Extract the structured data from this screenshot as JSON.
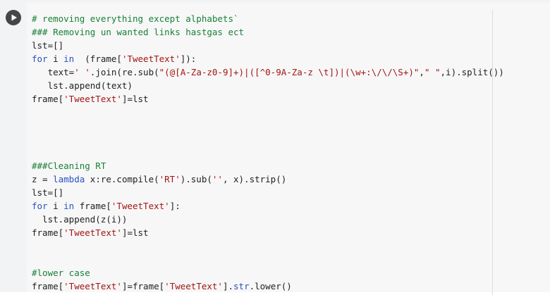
{
  "cell": {
    "run_icon": "play-icon",
    "colors": {
      "comment": "#188038",
      "keyword": "#2a52be",
      "string": "#a31515",
      "text": "#202124",
      "background": "#f7f7f7",
      "gutter": "#f1f3f4"
    },
    "lines": [
      [
        {
          "t": "comment",
          "v": "# removing everything except alphabets`"
        }
      ],
      [
        {
          "t": "comment",
          "v": "### Removing un wanted links hastgas ect"
        }
      ],
      [
        {
          "t": "plain",
          "v": "lst=[]"
        }
      ],
      [
        {
          "t": "keyword",
          "v": "for"
        },
        {
          "t": "plain",
          "v": " i "
        },
        {
          "t": "keyword",
          "v": "in"
        },
        {
          "t": "plain",
          "v": "  (frame["
        },
        {
          "t": "string",
          "v": "'TweetText'"
        },
        {
          "t": "plain",
          "v": "]):"
        }
      ],
      [
        {
          "t": "plain",
          "v": "   text="
        },
        {
          "t": "string",
          "v": "' '"
        },
        {
          "t": "plain",
          "v": ".join(re.sub("
        },
        {
          "t": "string",
          "v": "\"(@[A-Za-z0-9]+)|([^0-9A-Za-z \\t])|(\\w+:\\/\\/\\S+)\""
        },
        {
          "t": "plain",
          "v": ","
        },
        {
          "t": "string",
          "v": "\" \""
        },
        {
          "t": "plain",
          "v": ",i).split())"
        }
      ],
      [
        {
          "t": "plain",
          "v": "   lst.append(text)"
        }
      ],
      [
        {
          "t": "plain",
          "v": "frame["
        },
        {
          "t": "string",
          "v": "'TweetText'"
        },
        {
          "t": "plain",
          "v": "]=lst"
        }
      ],
      [],
      [],
      [],
      [],
      [
        {
          "t": "comment",
          "v": "###Cleaning RT"
        }
      ],
      [
        {
          "t": "plain",
          "v": "z = "
        },
        {
          "t": "keyword",
          "v": "lambda"
        },
        {
          "t": "plain",
          "v": " x:re.compile("
        },
        {
          "t": "string",
          "v": "'RT'"
        },
        {
          "t": "plain",
          "v": ").sub("
        },
        {
          "t": "string",
          "v": "''"
        },
        {
          "t": "plain",
          "v": ", x).strip()"
        }
      ],
      [
        {
          "t": "plain",
          "v": "lst=[]"
        }
      ],
      [
        {
          "t": "keyword",
          "v": "for"
        },
        {
          "t": "plain",
          "v": " i "
        },
        {
          "t": "keyword",
          "v": "in"
        },
        {
          "t": "plain",
          "v": " frame["
        },
        {
          "t": "string",
          "v": "'TweetText'"
        },
        {
          "t": "plain",
          "v": "]:"
        }
      ],
      [
        {
          "t": "plain",
          "v": "  lst.append(z(i))"
        }
      ],
      [
        {
          "t": "plain",
          "v": "frame["
        },
        {
          "t": "string",
          "v": "'TweetText'"
        },
        {
          "t": "plain",
          "v": "]=lst"
        }
      ],
      [],
      [],
      [
        {
          "t": "comment",
          "v": "#lower case"
        }
      ],
      [
        {
          "t": "plain",
          "v": "frame["
        },
        {
          "t": "string",
          "v": "'TweetText'"
        },
        {
          "t": "plain",
          "v": "]=frame["
        },
        {
          "t": "string",
          "v": "'TweetText'"
        },
        {
          "t": "plain",
          "v": "]."
        },
        {
          "t": "keyword",
          "v": "str"
        },
        {
          "t": "plain",
          "v": ".lower()"
        }
      ]
    ]
  }
}
